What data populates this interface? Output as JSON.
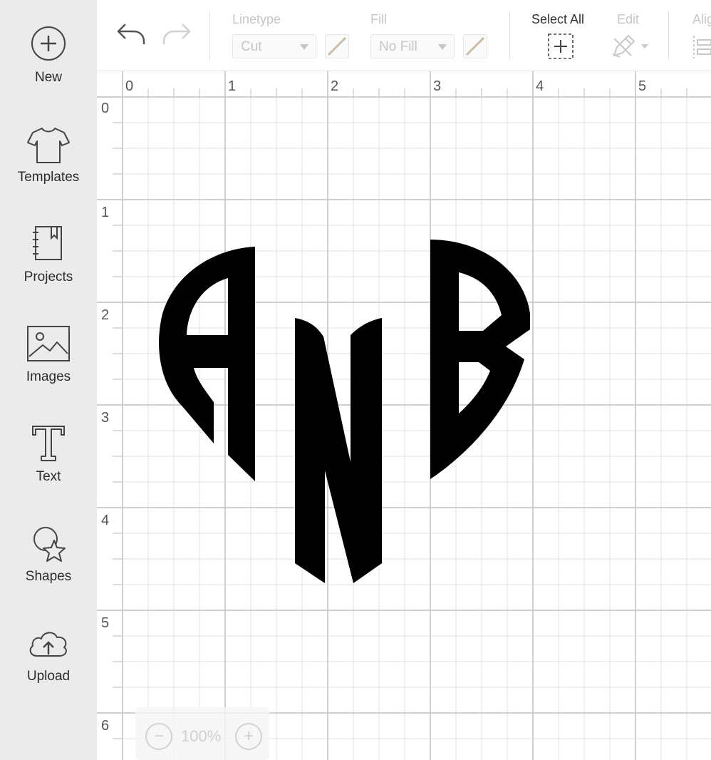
{
  "sidebar": {
    "items": [
      {
        "label": "New",
        "icon": "plus-circle-icon"
      },
      {
        "label": "Templates",
        "icon": "tshirt-icon"
      },
      {
        "label": "Projects",
        "icon": "notebook-icon"
      },
      {
        "label": "Images",
        "icon": "image-icon"
      },
      {
        "label": "Text",
        "icon": "text-t-icon"
      },
      {
        "label": "Shapes",
        "icon": "shapes-icon"
      },
      {
        "label": "Upload",
        "icon": "cloud-upload-icon"
      }
    ]
  },
  "toolbar": {
    "undo_icon": "undo-icon",
    "redo_icon": "redo-icon",
    "linetype": {
      "label": "Linetype",
      "value": "Cut"
    },
    "fill": {
      "label": "Fill",
      "value": "No Fill"
    },
    "select_all": {
      "label": "Select All",
      "icon": "select-all-icon"
    },
    "edit": {
      "label": "Edit",
      "icon": "edit-pencil-icon"
    },
    "align": {
      "label": "Alig"
    }
  },
  "canvas": {
    "ruler_x": [
      "0",
      "1",
      "2",
      "3",
      "4",
      "5"
    ],
    "ruler_y": [
      "0",
      "1",
      "2",
      "3",
      "4",
      "5",
      "6"
    ],
    "design": {
      "monogram": "ANB",
      "fill_color": "#000000"
    }
  },
  "zoom": {
    "minus": "−",
    "level": "100%",
    "plus": "+"
  }
}
